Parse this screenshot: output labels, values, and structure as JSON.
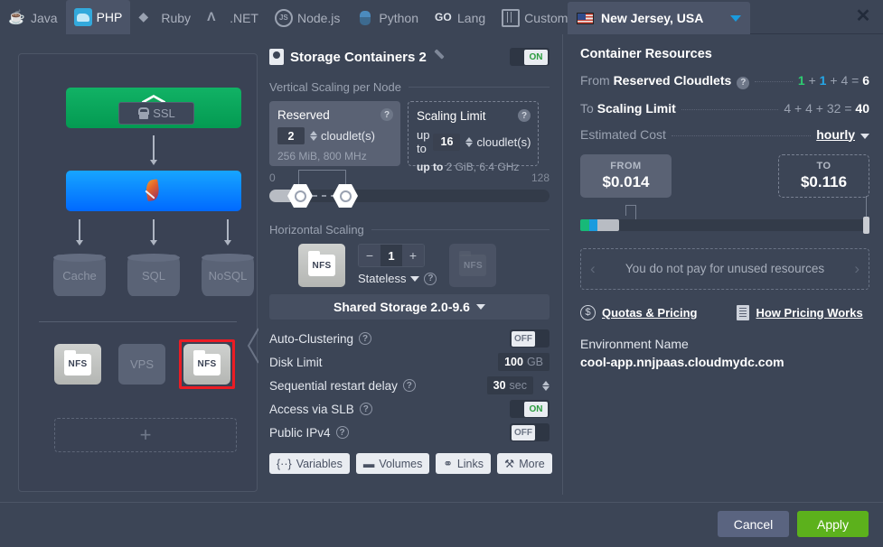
{
  "window": {
    "close_label": "✕"
  },
  "lang_tabs": [
    {
      "label": "Java",
      "icon": "java-icon",
      "active": false
    },
    {
      "label": "PHP",
      "icon": "php-icon",
      "active": true
    },
    {
      "label": "Ruby",
      "icon": "ruby-icon",
      "active": false
    },
    {
      "label": ".NET",
      "icon": "dotnet-icon",
      "active": false
    },
    {
      "label": "Node.js",
      "icon": "nodejs-icon",
      "active": false
    },
    {
      "label": "Python",
      "icon": "python-icon",
      "active": false
    },
    {
      "label": "Lang",
      "icon": "go-icon",
      "active": false
    },
    {
      "label": "Custom",
      "icon": "custom-icon",
      "active": false
    }
  ],
  "region": {
    "name": "New Jersey, USA",
    "flag": "us-flag-icon",
    "caret": "chevron-down-icon"
  },
  "topology": {
    "ssl_label": "SSL",
    "nodes": {
      "nginx": "nginx-logo",
      "apache": "apache-logo",
      "db_row": [
        "Cache",
        "SQL",
        "NoSQL"
      ],
      "storage_row": [
        "NFS",
        "VPS",
        "NFS"
      ],
      "add_label": "+"
    }
  },
  "settings": {
    "title": "Storage Containers 2",
    "edit_icon": "pencil-icon",
    "power_toggle": "ON",
    "vertical_section": "Vertical Scaling per Node",
    "reserved": {
      "title": "Reserved",
      "value": "2",
      "unit": "cloudlet(s)",
      "note": "256 MiB, 800 MHz",
      "help": "?"
    },
    "scaling_limit": {
      "title": "Scaling Limit",
      "prefix": "up to",
      "value": "16",
      "unit": "cloudlet(s)",
      "note_prefix": "up to",
      "note": "2 GiB, 6.4 GHz",
      "help": "?"
    },
    "slider": {
      "min": "0",
      "max": "128"
    },
    "horizontal_section": "Horizontal Scaling",
    "horizontal": {
      "node_label": "NFS",
      "ghost_label": "NFS",
      "minus": "−",
      "count": "1",
      "plus": "+",
      "mode": "Stateless",
      "help": "?"
    },
    "shared_storage": "Shared Storage 2.0-9.6",
    "options": [
      {
        "label": "Auto-Clustering",
        "help": true,
        "control": "toggle",
        "value": "OFF",
        "state": "off"
      },
      {
        "label": "Disk Limit",
        "help": false,
        "control": "value",
        "value": "100",
        "unit": "GB"
      },
      {
        "label": "Sequential restart delay",
        "help": true,
        "control": "spinner",
        "value": "30",
        "unit": "sec"
      },
      {
        "label": "Access via SLB",
        "help": true,
        "control": "toggle",
        "value": "ON",
        "state": "on"
      },
      {
        "label": "Public IPv4",
        "help": true,
        "control": "toggle",
        "value": "OFF",
        "state": "off"
      }
    ],
    "buttons": [
      {
        "label": "Variables",
        "icon": "variables-icon",
        "glyph": "{··}"
      },
      {
        "label": "Volumes",
        "icon": "volumes-icon",
        "glyph": "▬"
      },
      {
        "label": "Links",
        "icon": "links-icon",
        "glyph": "⚭"
      },
      {
        "label": "More",
        "icon": "wrench-icon",
        "glyph": "⚒"
      }
    ]
  },
  "pricing": {
    "heading": "Container Resources",
    "from_reserved": {
      "prefix": "From ",
      "label": "Reserved Cloudlets",
      "help": "?",
      "a": "1",
      "b": "1",
      "c": "4",
      "total": "6"
    },
    "to_limit": {
      "prefix": "To ",
      "label": "Scaling Limit",
      "a": "4",
      "b": "4",
      "c": "32",
      "total": "40"
    },
    "estimated_cost": {
      "label": "Estimated Cost",
      "period": "hourly"
    },
    "from_box": {
      "caption": "FROM",
      "amount": "$0.014"
    },
    "to_box": {
      "caption": "TO",
      "amount": "$0.116"
    },
    "unused_note": "You do not pay for unused resources",
    "links": [
      {
        "label": "Quotas & Pricing",
        "icon": "dollar-circle-icon"
      },
      {
        "label": "How Pricing Works",
        "icon": "document-icon"
      }
    ],
    "environment": {
      "label": "Environment Name",
      "value": "cool-app.nnjpaas.cloudmydc.com"
    }
  },
  "footer": {
    "cancel": "Cancel",
    "apply": "Apply"
  },
  "colors": {
    "accent_blue": "#1a9bde",
    "green": "#2ecc71",
    "apply_green": "#5cb11c",
    "selection_red": "#ec1c24",
    "panel_bg": "#3c4556"
  }
}
